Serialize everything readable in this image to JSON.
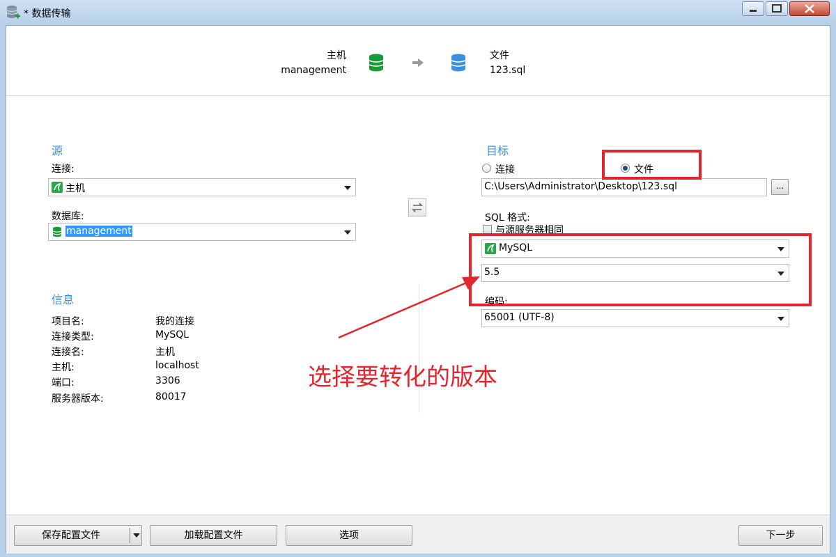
{
  "window": {
    "title": "* 数据传输"
  },
  "header": {
    "source": {
      "title": "主机",
      "name": "management"
    },
    "target": {
      "title": "文件",
      "name": "123.sql"
    }
  },
  "source": {
    "heading": "源",
    "connection_label": "连接:",
    "connection_value": "主机",
    "database_label": "数据库:",
    "database_value": "management"
  },
  "info": {
    "heading": "信息",
    "rows": [
      {
        "key": "项目名:",
        "value": "我的连接"
      },
      {
        "key": "连接类型:",
        "value": "MySQL"
      },
      {
        "key": "连接名:",
        "value": "主机"
      },
      {
        "key": "主机:",
        "value": "localhost"
      },
      {
        "key": "端口:",
        "value": "3306"
      },
      {
        "key": "服务器版本:",
        "value": "80017"
      }
    ]
  },
  "target": {
    "heading": "目标",
    "radio_connection": "连接",
    "radio_file": "文件",
    "selected": "file",
    "file_path": "C:\\Users\\Administrator\\Desktop\\123.sql",
    "browse_label": "...",
    "sql_format_label": "SQL 格式:",
    "same_as_source_label": "与源服务器相同",
    "same_as_source_checked": false,
    "server_type": "MySQL",
    "version": "5.5",
    "encoding_label": "编码:",
    "encoding_value": "65001 (UTF-8)"
  },
  "annotation": {
    "text": "选择要转化的版本",
    "color": "#e3262e"
  },
  "footer": {
    "save_profile": "保存配置文件",
    "load_profile": "加载配置文件",
    "options": "选项",
    "next": "下一步"
  },
  "colors": {
    "accent": "#3b8fd0",
    "source_db": "#1a9a36",
    "target_db": "#3a8fe0",
    "highlight": "#e3262e"
  }
}
